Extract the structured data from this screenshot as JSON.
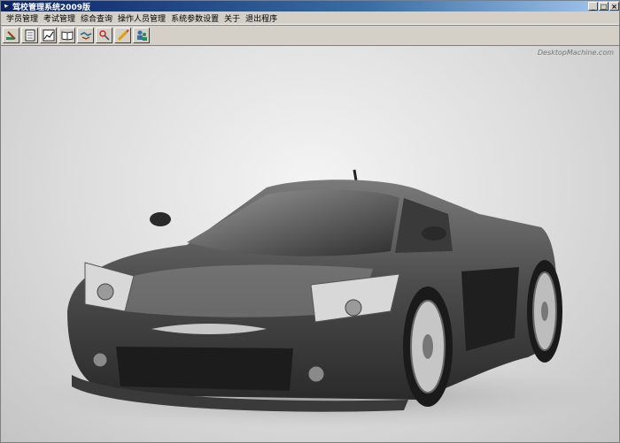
{
  "window": {
    "title": "驾校管理系统2009版",
    "controls": [
      "_",
      "□",
      "×"
    ]
  },
  "menu": [
    "学员管理",
    "考试管理",
    "综合查询",
    "操作人员管理",
    "系统参数设置",
    "关于",
    "退出程序"
  ],
  "toolbar": {
    "icons": [
      "edit-icon",
      "notebook-icon",
      "chart-icon",
      "book-icon",
      "handshake-icon",
      "tools-icon",
      "pencil-icon",
      "users-icon"
    ]
  },
  "content": {
    "watermark": "DesktopMachine.com",
    "image": "silver-concept-sports-car"
  }
}
